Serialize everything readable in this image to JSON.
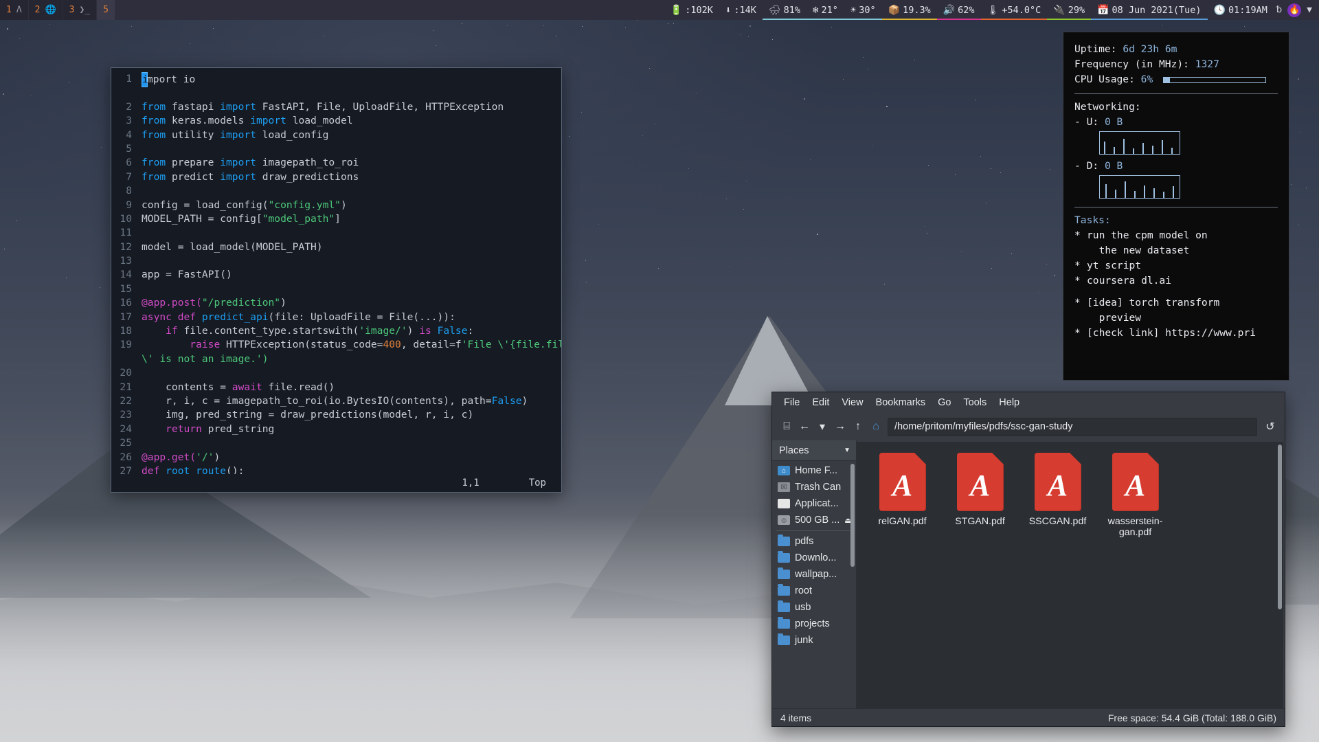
{
  "topbar": {
    "workspaces": [
      {
        "num": "1",
        "icon": "arch-logo-icon",
        "glyph": "Λ",
        "focused": false
      },
      {
        "num": "2",
        "icon": "globe-icon",
        "glyph": "🌐",
        "focused": false
      },
      {
        "num": "3",
        "icon": "terminal-icon",
        "glyph": "❯_",
        "focused": false
      },
      {
        "num": "5",
        "icon": "",
        "glyph": "",
        "focused": true
      }
    ],
    "tray": [
      {
        "name": "upload-speed",
        "icon": "upload-icon",
        "glyph": "🔋",
        "text": ":102K",
        "accent": ""
      },
      {
        "name": "download-speed",
        "icon": "download-arrow-icon",
        "glyph": "⬇",
        "text": ":14K",
        "accent": ""
      },
      {
        "name": "humidity",
        "icon": "rain-cloud-icon",
        "glyph": "🌧",
        "text": "81%",
        "accent": "#7fc8d8"
      },
      {
        "name": "temp-low",
        "icon": "snowflake-icon",
        "glyph": "❄",
        "text": "21°",
        "accent": "#7fc8d8"
      },
      {
        "name": "temp-high",
        "icon": "sun-icon",
        "glyph": "☀",
        "text": "30°",
        "accent": "#7fc8d8"
      },
      {
        "name": "memory-usage",
        "icon": "package-icon",
        "glyph": "📦",
        "text": "19.3%",
        "accent": "#d8b431"
      },
      {
        "name": "volume",
        "icon": "speaker-icon",
        "glyph": "🔊",
        "text": "62%",
        "accent": "#d6338f"
      },
      {
        "name": "cpu-temperature",
        "icon": "thermometer-icon",
        "glyph": "🌡",
        "text": "+54.0°C",
        "accent": "#e2662c"
      },
      {
        "name": "battery",
        "icon": "battery-icon",
        "glyph": "🔌",
        "text": "29%",
        "accent": "#8fc72c"
      },
      {
        "name": "date",
        "icon": "calendar-icon",
        "glyph": "📅",
        "text": "08 Jun 2021(Tue)",
        "accent": "#5b9bd5"
      },
      {
        "name": "clock",
        "icon": "clock-icon",
        "glyph": "🕓",
        "text": "01:19AM",
        "accent": ""
      }
    ],
    "end_icons": [
      {
        "name": "bluetooth-off-icon",
        "glyph": "␢"
      },
      {
        "name": "firefox-icon",
        "glyph": "🔥"
      },
      {
        "name": "wifi-icon",
        "glyph": "▼"
      }
    ]
  },
  "editor": {
    "cursor_position": "1,1",
    "scroll_position": "Top",
    "lines": [
      {
        "n": "1",
        "segs": [
          {
            "t": "i",
            "c": "cursor"
          },
          {
            "t": "mport io",
            "c": "plain"
          }
        ]
      },
      {
        "n": "",
        "segs": []
      },
      {
        "n": "2",
        "segs": [
          {
            "t": "from ",
            "c": "kw2"
          },
          {
            "t": "fastapi ",
            "c": "plain"
          },
          {
            "t": "import ",
            "c": "kw2"
          },
          {
            "t": "FastAPI, File, UploadFile, HTTPException",
            "c": "plain"
          }
        ]
      },
      {
        "n": "3",
        "segs": [
          {
            "t": "from ",
            "c": "kw2"
          },
          {
            "t": "keras.models ",
            "c": "plain"
          },
          {
            "t": "import ",
            "c": "kw2"
          },
          {
            "t": "load_model",
            "c": "plain"
          }
        ]
      },
      {
        "n": "4",
        "segs": [
          {
            "t": "from ",
            "c": "kw2"
          },
          {
            "t": "utility ",
            "c": "plain"
          },
          {
            "t": "import ",
            "c": "kw2"
          },
          {
            "t": "load_config",
            "c": "plain"
          }
        ]
      },
      {
        "n": "5",
        "segs": []
      },
      {
        "n": "6",
        "segs": [
          {
            "t": "from ",
            "c": "kw2"
          },
          {
            "t": "prepare ",
            "c": "plain"
          },
          {
            "t": "import ",
            "c": "kw2"
          },
          {
            "t": "imagepath_to_roi",
            "c": "plain"
          }
        ]
      },
      {
        "n": "7",
        "segs": [
          {
            "t": "from ",
            "c": "kw2"
          },
          {
            "t": "predict ",
            "c": "plain"
          },
          {
            "t": "import ",
            "c": "kw2"
          },
          {
            "t": "draw_predictions",
            "c": "plain"
          }
        ]
      },
      {
        "n": "8",
        "segs": []
      },
      {
        "n": "9",
        "segs": [
          {
            "t": "config = load_config(",
            "c": "plain"
          },
          {
            "t": "\"config.yml\"",
            "c": "str"
          },
          {
            "t": ")",
            "c": "plain"
          }
        ]
      },
      {
        "n": "10",
        "segs": [
          {
            "t": "MODEL_PATH = config[",
            "c": "plain"
          },
          {
            "t": "\"model_path\"",
            "c": "str"
          },
          {
            "t": "]",
            "c": "plain"
          }
        ]
      },
      {
        "n": "11",
        "segs": []
      },
      {
        "n": "12",
        "segs": [
          {
            "t": "model = load_model(MODEL_PATH)",
            "c": "plain"
          }
        ]
      },
      {
        "n": "13",
        "segs": []
      },
      {
        "n": "14",
        "segs": [
          {
            "t": "app = FastAPI()",
            "c": "plain"
          }
        ]
      },
      {
        "n": "15",
        "segs": []
      },
      {
        "n": "16",
        "segs": [
          {
            "t": "@app.post(",
            "c": "dec"
          },
          {
            "t": "\"/prediction\"",
            "c": "str"
          },
          {
            "t": ")",
            "c": "plain"
          }
        ]
      },
      {
        "n": "17",
        "segs": [
          {
            "t": "async def ",
            "c": "kw"
          },
          {
            "t": "predict_api",
            "c": "kw2"
          },
          {
            "t": "(file: UploadFile = File(...)):",
            "c": "plain"
          }
        ]
      },
      {
        "n": "18",
        "segs": [
          {
            "t": "    ",
            "c": "plain"
          },
          {
            "t": "if ",
            "c": "kw"
          },
          {
            "t": "file.content_type.startswith(",
            "c": "plain"
          },
          {
            "t": "'image/'",
            "c": "str"
          },
          {
            "t": ") ",
            "c": "plain"
          },
          {
            "t": "is ",
            "c": "kw"
          },
          {
            "t": "False",
            "c": "kw2"
          },
          {
            "t": ":",
            "c": "plain"
          }
        ]
      },
      {
        "n": "19",
        "segs": [
          {
            "t": "        ",
            "c": "plain"
          },
          {
            "t": "raise ",
            "c": "kw"
          },
          {
            "t": "HTTPException(status_code=",
            "c": "plain"
          },
          {
            "t": "400",
            "c": "num"
          },
          {
            "t": ", detail=f",
            "c": "plain"
          },
          {
            "t": "'File \\'{file.filename}",
            "c": "str"
          }
        ]
      },
      {
        "n": "",
        "segs": [
          {
            "t": "\\' is not an image.')",
            "c": "str"
          }
        ]
      },
      {
        "n": "20",
        "segs": []
      },
      {
        "n": "21",
        "segs": [
          {
            "t": "    contents = ",
            "c": "plain"
          },
          {
            "t": "await ",
            "c": "kw"
          },
          {
            "t": "file.read()",
            "c": "plain"
          }
        ]
      },
      {
        "n": "22",
        "segs": [
          {
            "t": "    r, i, c = imagepath_to_roi(io.BytesIO(contents), path=",
            "c": "plain"
          },
          {
            "t": "False",
            "c": "kw2"
          },
          {
            "t": ")",
            "c": "plain"
          }
        ]
      },
      {
        "n": "23",
        "segs": [
          {
            "t": "    img, pred_string = draw_predictions(model, r, i, c)",
            "c": "plain"
          }
        ]
      },
      {
        "n": "24",
        "segs": [
          {
            "t": "    ",
            "c": "plain"
          },
          {
            "t": "return ",
            "c": "kw"
          },
          {
            "t": "pred_string",
            "c": "plain"
          }
        ]
      },
      {
        "n": "25",
        "segs": []
      },
      {
        "n": "26",
        "segs": [
          {
            "t": "@app.get(",
            "c": "dec"
          },
          {
            "t": "'/'",
            "c": "str"
          },
          {
            "t": ")",
            "c": "plain"
          }
        ]
      },
      {
        "n": "27",
        "segs": [
          {
            "t": "def ",
            "c": "kw"
          },
          {
            "t": "root_route",
            "c": "kw2"
          },
          {
            "t": "():",
            "c": "plain"
          }
        ]
      }
    ]
  },
  "conky": {
    "uptime_label": "Uptime:",
    "uptime_value": "6d 23h 6m",
    "frequency_label": "Frequency (in MHz):",
    "frequency_value": "1327",
    "cpu_label": "CPU Usage:",
    "cpu_value": "6%",
    "cpu_percent": 6,
    "networking_label": "Networking:",
    "upload_label": "- U:",
    "upload_value": "0 B",
    "download_label": "- D:",
    "download_value": "0 B",
    "tasks_label": "Tasks:",
    "tasks": [
      {
        "bullet": "*",
        "text": "run the cpm model on\n  the new dataset"
      },
      {
        "bullet": "*",
        "text": "yt script"
      },
      {
        "bullet": "*",
        "text": "coursera dl.ai"
      },
      {
        "bullet": "",
        "text": ""
      },
      {
        "bullet": "*",
        "text": "[idea] torch transform\n  preview"
      },
      {
        "bullet": "*",
        "text": "[check link] https://www.pri"
      }
    ]
  },
  "filemanager": {
    "menu": [
      "File",
      "Edit",
      "View",
      "Bookmarks",
      "Go",
      "Tools",
      "Help"
    ],
    "toolbar_icons": [
      {
        "name": "device-icon",
        "glyph": "⌸"
      },
      {
        "name": "back-icon",
        "glyph": "←"
      },
      {
        "name": "history-dropdown-icon",
        "glyph": "▾"
      },
      {
        "name": "forward-icon",
        "glyph": "→"
      },
      {
        "name": "up-icon",
        "glyph": "↑"
      },
      {
        "name": "home-folder-icon",
        "glyph": "⌂"
      }
    ],
    "path": "/home/pritom/myfiles/pdfs/ssc-gan-study",
    "reload_icon": "↺",
    "sidebar_header": "Places",
    "sidebar_dropdown_icon": "▼",
    "places": [
      {
        "label": "Home F...",
        "icon": "home-folder-icon",
        "kind": "home",
        "eject": false
      },
      {
        "label": "Trash Can",
        "icon": "trash-icon",
        "kind": "trash",
        "eject": false
      },
      {
        "label": "Applicat...",
        "icon": "applications-icon",
        "kind": "apps",
        "eject": false
      },
      {
        "label": "500 GB ...",
        "icon": "drive-icon",
        "kind": "drive",
        "eject": true
      },
      {
        "label": "pdfs",
        "icon": "folder-icon",
        "kind": "folder",
        "eject": false
      },
      {
        "label": "Downlo...",
        "icon": "folder-icon",
        "kind": "folder",
        "eject": false
      },
      {
        "label": "wallpap...",
        "icon": "folder-icon",
        "kind": "folder",
        "eject": false
      },
      {
        "label": "root",
        "icon": "folder-icon",
        "kind": "folder",
        "eject": false
      },
      {
        "label": "usb",
        "icon": "folder-icon",
        "kind": "folder",
        "eject": false
      },
      {
        "label": "projects",
        "icon": "folder-icon",
        "kind": "folder",
        "eject": false
      },
      {
        "label": "junk",
        "icon": "folder-icon",
        "kind": "folder",
        "eject": false
      }
    ],
    "files": [
      {
        "name": "relGAN.pdf",
        "icon": "pdf-file-icon"
      },
      {
        "name": "STGAN.pdf",
        "icon": "pdf-file-icon"
      },
      {
        "name": "SSCGAN.pdf",
        "icon": "pdf-file-icon"
      },
      {
        "name": "wasserstein-gan.pdf",
        "icon": "pdf-file-icon"
      }
    ],
    "status_left": "4 items",
    "status_right": "Free space: 54.4 GiB (Total: 188.0 GiB)"
  }
}
